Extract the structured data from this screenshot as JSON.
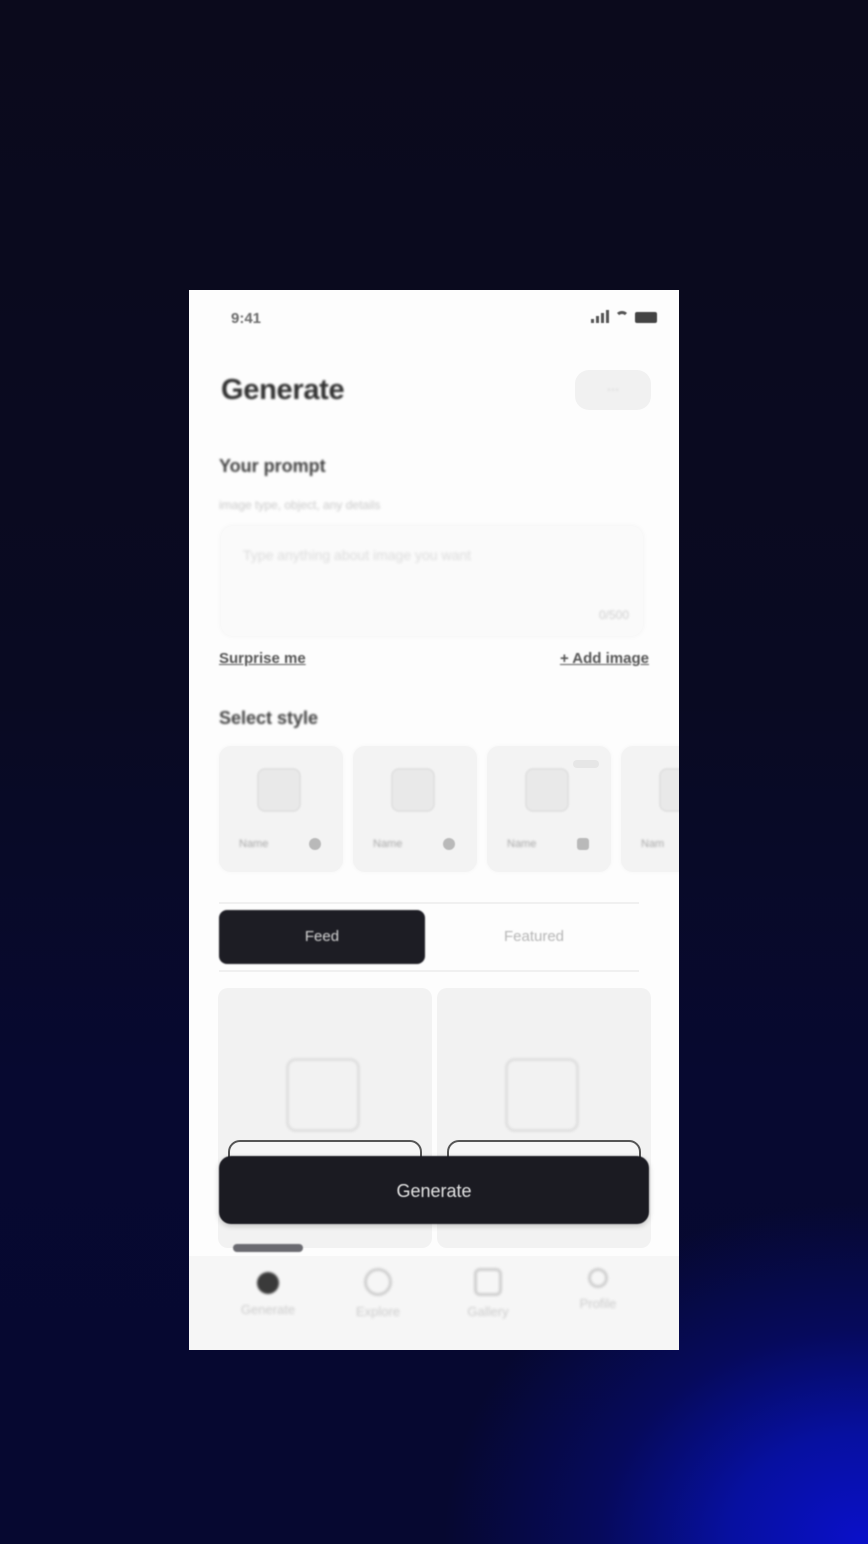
{
  "status_bar": {
    "time": "9:41"
  },
  "header": {
    "title": "Generate",
    "pill_label": "···"
  },
  "prompt": {
    "label": "Your prompt",
    "sublabel": "image type, object, any details",
    "placeholder": "Type anything about image you want",
    "char_count": "0/500"
  },
  "links": {
    "surprise": "Surprise me",
    "add_image": "+ Add image"
  },
  "style_section": {
    "label": "Select style",
    "cards": [
      {
        "name": "Name"
      },
      {
        "name": "Name"
      },
      {
        "name": "Name"
      },
      {
        "name": "Nam"
      }
    ]
  },
  "tabs": {
    "feed": "Feed",
    "featured": "Featured"
  },
  "generate_button": "Generate",
  "tab_bar": {
    "items": [
      {
        "label": "Generate",
        "icon": "sparkle-icon"
      },
      {
        "label": "Explore",
        "icon": "compass-icon"
      },
      {
        "label": "Gallery",
        "icon": "gallery-icon"
      },
      {
        "label": "Profile",
        "icon": "profile-icon"
      }
    ]
  }
}
